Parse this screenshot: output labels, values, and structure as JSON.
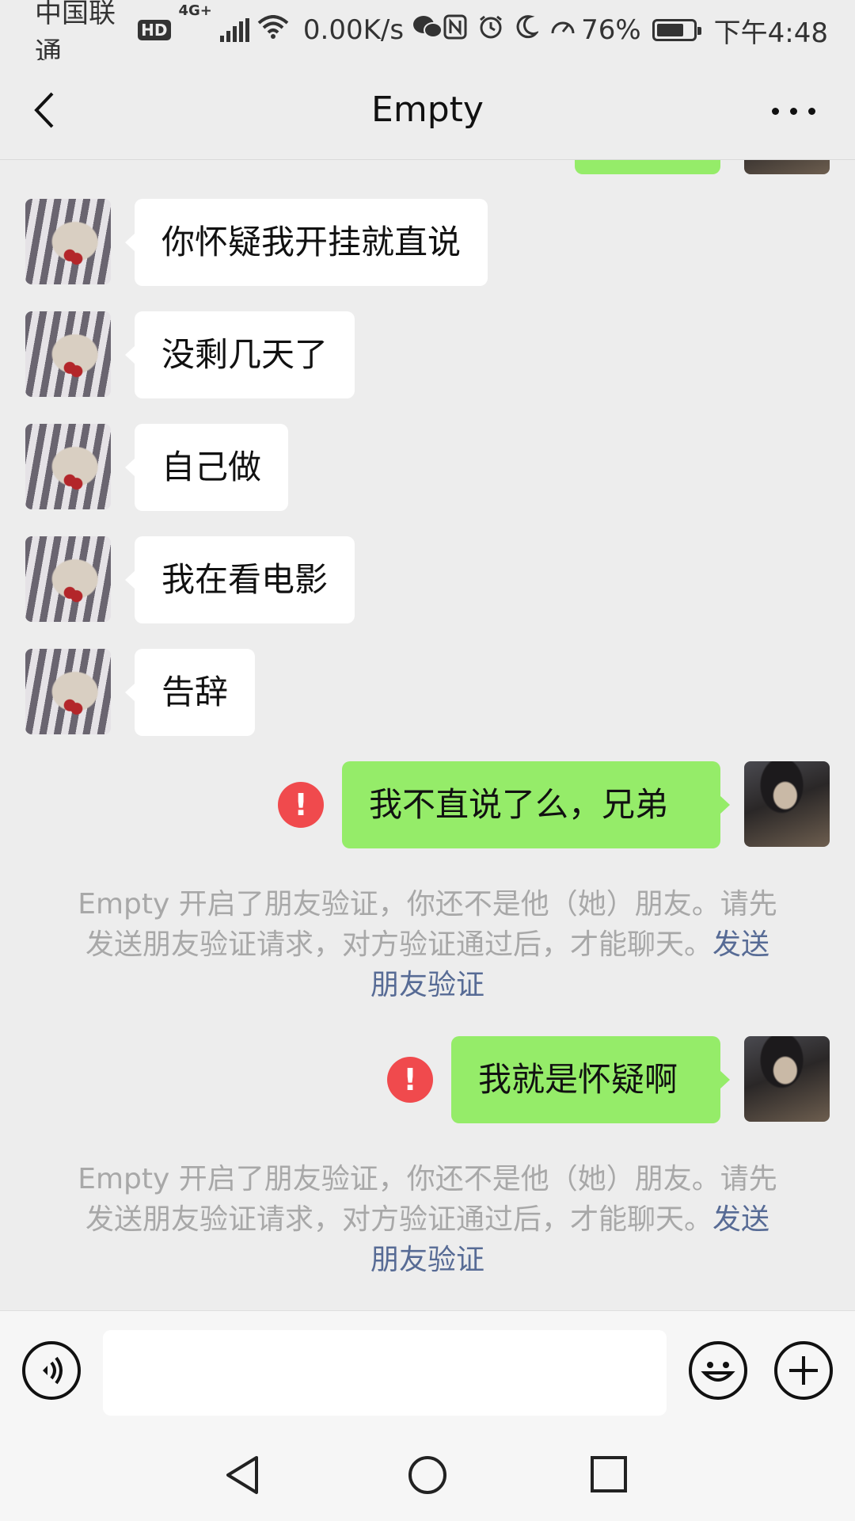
{
  "status_bar": {
    "carrier": "中国联通",
    "hd": "HD",
    "network": "4G+",
    "speed": "0.00K/s",
    "battery_percent": "76%",
    "battery_level": 0.76,
    "time": "下午4:48",
    "icons": [
      "signal-icon",
      "wifi-icon",
      "wechat-icon",
      "nfc-icon",
      "alarm-icon",
      "moon-icon",
      "speedometer-icon",
      "battery-icon"
    ]
  },
  "nav": {
    "title": "Empty",
    "back_icon": "chevron-left-icon",
    "more_icon": "more-dots-icon"
  },
  "messages": [
    {
      "side": "left",
      "text": "你怀疑我开挂就直说"
    },
    {
      "side": "left",
      "text": "没剩几天了"
    },
    {
      "side": "left",
      "text": "自己做"
    },
    {
      "side": "left",
      "text": "我在看电影"
    },
    {
      "side": "left",
      "text": "告辞"
    },
    {
      "side": "right",
      "text": "我不直说了么，兄弟",
      "failed": true
    },
    {
      "side": "right",
      "text": "我就是怀疑啊",
      "failed": true
    }
  ],
  "notices": [
    {
      "line1": "Empty 开启了朋友验证，你还不是他（她）朋友。请先",
      "line2": "发送朋友验证请求，对方验证通过后，才能聊天。",
      "link_a": "发送",
      "link_b": "朋友验证"
    },
    {
      "line1": "Empty 开启了朋友验证，你还不是他（她）朋友。请先",
      "line2": "发送朋友验证请求，对方验证通过后，才能聊天。",
      "link_a": "发送",
      "link_b": "朋友验证"
    }
  ],
  "error_mark": "!",
  "input": {
    "value": "",
    "voice_icon": "voice-icon",
    "emoji_icon": "emoji-icon",
    "plus_icon": "plus-icon"
  },
  "system_nav": [
    "back-triangle-icon",
    "home-circle-icon",
    "recents-square-icon"
  ]
}
